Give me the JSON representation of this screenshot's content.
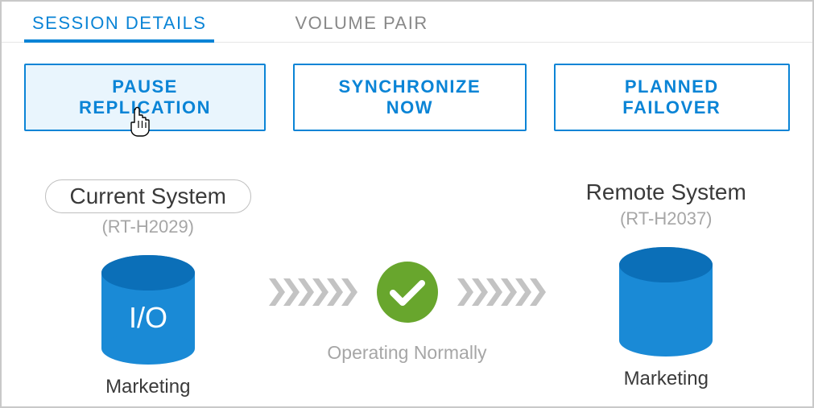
{
  "tabs": {
    "session_details": "SESSION DETAILS",
    "volume_pair": "VOLUME PAIR"
  },
  "actions": {
    "pause": "PAUSE REPLICATION",
    "sync": "SYNCHRONIZE NOW",
    "failover": "PLANNED FAILOVER"
  },
  "current_system": {
    "label": "Current System",
    "id": "(RT-H2029)",
    "io_text": "I/O",
    "volume": "Marketing"
  },
  "remote_system": {
    "label": "Remote System",
    "id": "(RT-H2037)",
    "volume": "Marketing"
  },
  "status": {
    "label": "Operating Normally"
  },
  "colors": {
    "primary": "#0a84d6",
    "ok": "#6aa92f"
  }
}
